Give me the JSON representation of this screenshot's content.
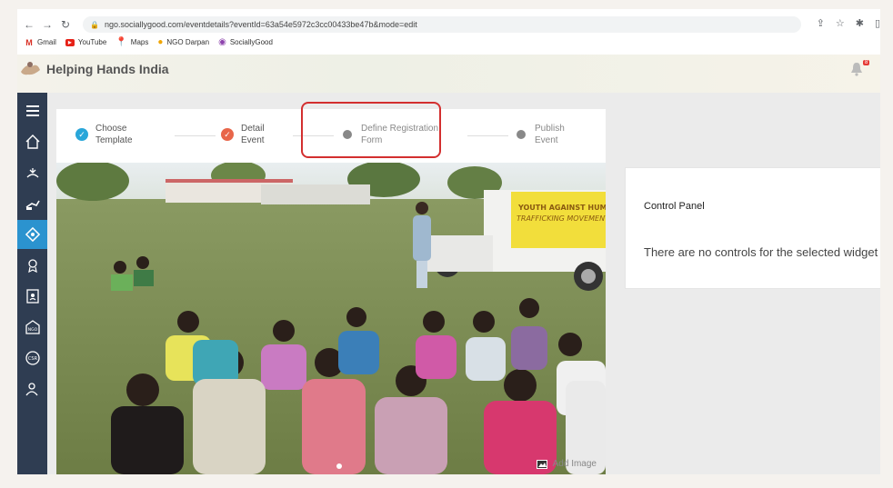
{
  "browser": {
    "url": "ngo.sociallygood.com/eventdetails?eventId=63a54e5972c3cc00433be47b&mode=edit",
    "bookmarks": [
      {
        "label": "Gmail"
      },
      {
        "label": "YouTube"
      },
      {
        "label": "Maps"
      },
      {
        "label": "NGO Darpan"
      },
      {
        "label": "SociallyGood"
      }
    ]
  },
  "header": {
    "org_name": "Helping Hands India",
    "notification_count": "8"
  },
  "steps": [
    {
      "line1": "Choose",
      "line2": "Template",
      "status": "done"
    },
    {
      "line1": "Detail",
      "line2": "Event",
      "status": "done"
    },
    {
      "line1": "Define Registration",
      "line2": "Form",
      "status": "pending"
    },
    {
      "line1": "Publish",
      "line2": "Event",
      "status": "pending"
    }
  ],
  "photo": {
    "banner_line1": "YOUTH AGAINST HUMAN",
    "banner_line2": "TRAFFICKING MOVEMENT",
    "add_image_label": "Add Image"
  },
  "control_panel": {
    "title": "Control Panel",
    "message": "There are no controls for the selected widget"
  },
  "colors": {
    "sidebar": "#2f3d52",
    "active": "#2b93cf",
    "step_done_1": "#29a6d9",
    "step_done_2": "#e8664a",
    "highlight": "#d32f2f"
  }
}
